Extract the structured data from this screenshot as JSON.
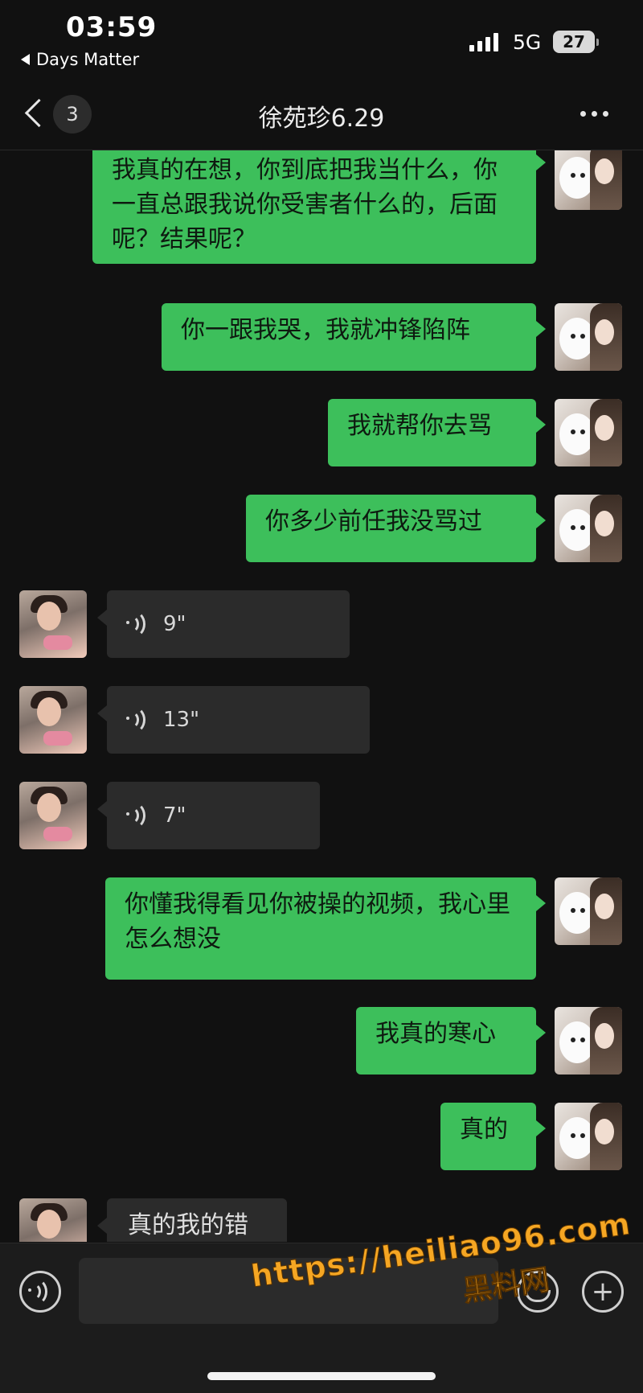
{
  "status_bar": {
    "time": "03:59",
    "back_app": "Days Matter",
    "network": "5G",
    "battery": "27"
  },
  "nav": {
    "unread_count": "3",
    "title": "徐苑珍6.29"
  },
  "messages": [
    {
      "sender": "me",
      "type": "text",
      "text": "我真的在想，你到底把我当什么，你一直总跟我说你受害者什么的，后面呢？结果呢？"
    },
    {
      "sender": "me",
      "type": "text",
      "text": "你一跟我哭，我就冲锋陷阵"
    },
    {
      "sender": "me",
      "type": "text",
      "text": "我就帮你去骂"
    },
    {
      "sender": "me",
      "type": "text",
      "text": "你多少前任我没骂过"
    },
    {
      "sender": "other",
      "type": "voice",
      "duration": "9\""
    },
    {
      "sender": "other",
      "type": "voice",
      "duration": "13\""
    },
    {
      "sender": "other",
      "type": "voice",
      "duration": "7\""
    },
    {
      "sender": "me",
      "type": "text",
      "text": "你懂我得看见你被操的视频，我心里怎么想没"
    },
    {
      "sender": "me",
      "type": "text",
      "text": "我真的寒心"
    },
    {
      "sender": "me",
      "type": "text",
      "text": "真的"
    },
    {
      "sender": "other",
      "type": "text",
      "text": "真的我的错"
    }
  ],
  "input_bar": {
    "voice_icon": "voice-toggle-icon",
    "emoji_icon": "emoji-icon",
    "plus_icon": "plus-icon"
  },
  "watermark": {
    "url": "https://heiliao96.com",
    "name": "黑料网"
  },
  "colors": {
    "background": "#111111",
    "my_bubble": "#3dbf5b",
    "other_bubble": "#2b2b2b",
    "watermark": "#f5a623"
  }
}
